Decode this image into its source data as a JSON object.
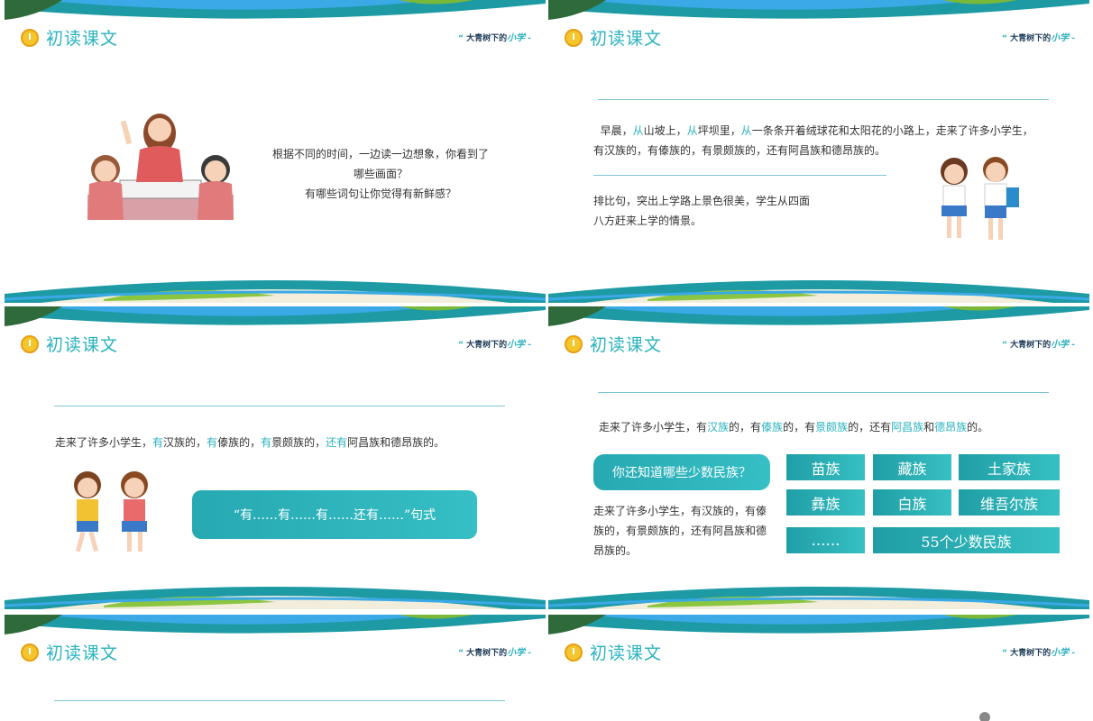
{
  "common": {
    "section_title": "初读课文",
    "brand": "大青树下的",
    "brand_accent": "小学",
    "accent_color": "#2bb3bf",
    "tile_color": "#1f9ea5"
  },
  "slide1": {
    "line1": "根据不同的时间，一边读一边想象，你看到了",
    "line2": "哪些画面？",
    "line3": "有哪些词句让你觉得有新鲜感？"
  },
  "slide2": {
    "p1_a": "早晨，",
    "p1_b": "从",
    "p1_c": "山坡上，",
    "p1_d": "从",
    "p1_e": "坪坝里，",
    "p1_f": "从",
    "p1_g": "一条条开着绒球花和太阳花的小路上，走来了许多小学生，",
    "p2": "有汉族的，有傣族的，有景颇族的，还有阿昌族和德昂族的。",
    "note1": "排比句，突出上学路上景色很美，学生从四面",
    "note2": "八方赶来上学的情景。"
  },
  "slide3": {
    "s_a": "走来了许多小学生，",
    "s_b": "有",
    "s_c": "汉族的，",
    "s_d": "有",
    "s_e": "傣族的，",
    "s_f": "有",
    "s_g": "景颇族的，",
    "s_h": "还有",
    "s_i": "阿昌族和德昂族的。",
    "pattern": "“有……有……有……还有……”句式"
  },
  "slide4": {
    "s_a": "走来了许多小学生，有",
    "s_b": "汉族",
    "s_c": "的，有",
    "s_d": "傣族",
    "s_e": "的，有",
    "s_f": "景颇族",
    "s_g": "的，还有",
    "s_h": "阿昌族",
    "s_i": "和",
    "s_j": "德昂族",
    "s_k": "的。",
    "question": "你还知道哪些少数民族？",
    "body1": "走来了许多小学生，有汉族的，有傣",
    "body2": "族的，有景颇族的，还有阿昌族和德",
    "body3": "昂族的。",
    "tiles": [
      "苗族",
      "藏族",
      "土家族",
      "彝族",
      "白族",
      "维吾尔族",
      "……",
      "55个少数民族"
    ]
  }
}
